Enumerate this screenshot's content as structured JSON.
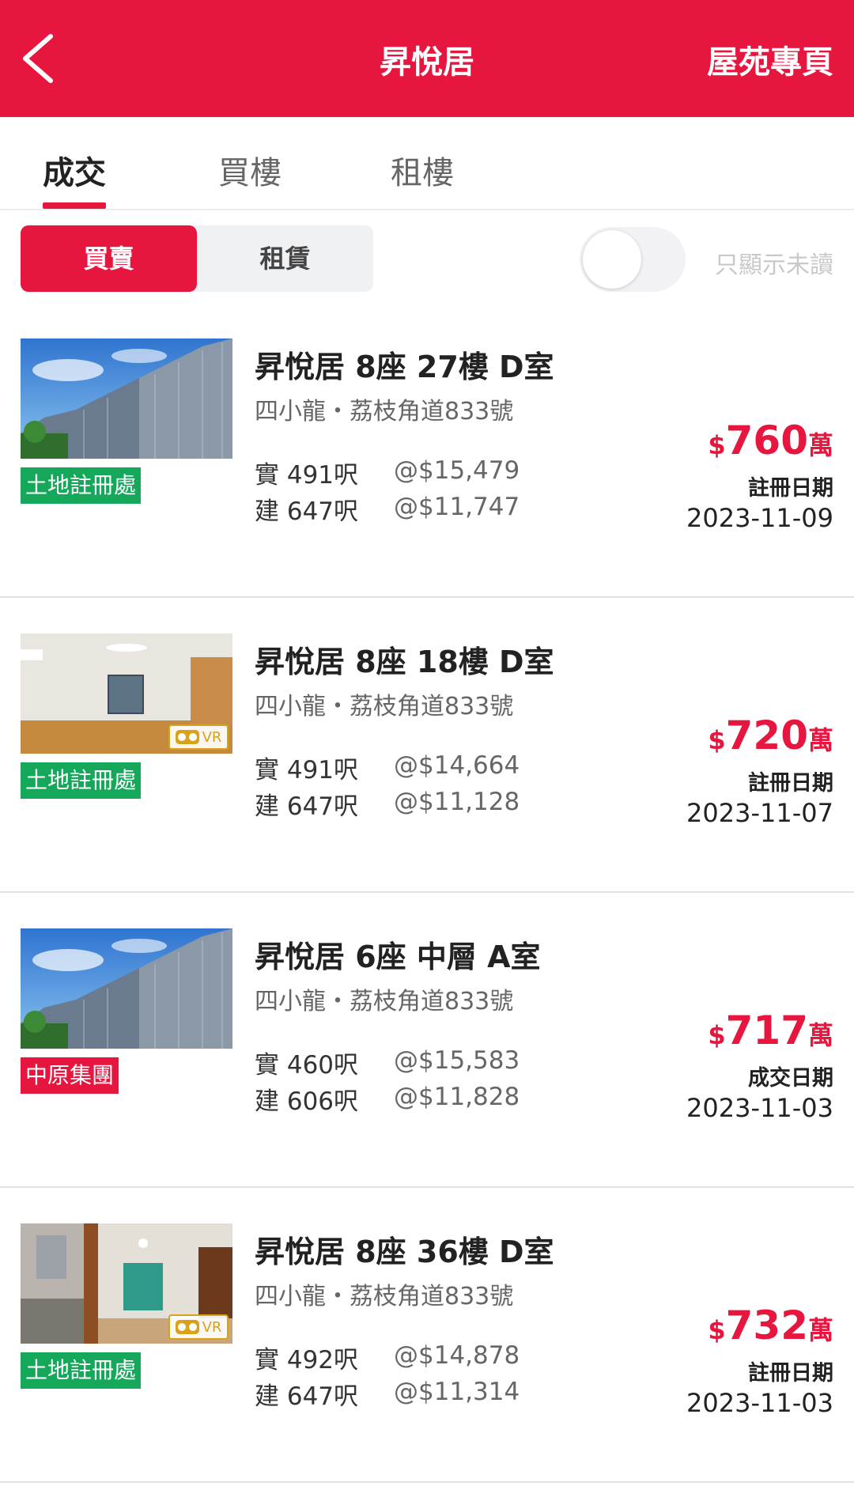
{
  "header": {
    "title": "昇悅居",
    "link": "屋苑專頁",
    "back_icon": "chevron-left-icon"
  },
  "tabs": [
    {
      "label": "成交",
      "active": true
    },
    {
      "label": "買樓"
    },
    {
      "label": "租樓"
    }
  ],
  "segment": {
    "active": "買賣",
    "inactive": "租賃"
  },
  "unread_toggle": {
    "label": "只顯示未讀",
    "on": false
  },
  "colors": {
    "brand": "#e6163f",
    "land_registry_tag": "#16a85a",
    "centaline_tag": "#e6163f",
    "vr_badge": "#d8a318"
  },
  "listings": [
    {
      "title": "昇悅居 8座 27樓 D室",
      "address": "四小龍・荔枝角道833號",
      "source": "土地註冊處",
      "image": "building-exterior-photo",
      "vr": false,
      "saleable": "實 491呎",
      "gross": "建 647呎",
      "saleable_unit_price": "@$15,479",
      "gross_unit_price": "@$11,747",
      "price_currency": "$",
      "price": "760",
      "price_unit": "萬",
      "date_label": "註冊日期",
      "date": "2023-11-09"
    },
    {
      "title": "昇悅居 8座 18樓 D室",
      "address": "四小龍・荔枝角道833號",
      "source": "土地註冊處",
      "image": "interior-room-photo",
      "vr": true,
      "vr_label": "VR",
      "saleable": "實 491呎",
      "gross": "建 647呎",
      "saleable_unit_price": "@$14,664",
      "gross_unit_price": "@$11,128",
      "price_currency": "$",
      "price": "720",
      "price_unit": "萬",
      "date_label": "註冊日期",
      "date": "2023-11-07"
    },
    {
      "title": "昇悅居 6座 中層 A室",
      "address": "四小龍・荔枝角道833號",
      "source": "中原集團",
      "image": "building-exterior-photo",
      "vr": false,
      "saleable": "實 460呎",
      "gross": "建 606呎",
      "saleable_unit_price": "@$15,583",
      "gross_unit_price": "@$11,828",
      "price_currency": "$",
      "price": "717",
      "price_unit": "萬",
      "date_label": "成交日期",
      "date": "2023-11-03"
    },
    {
      "title": "昇悅居 8座 36樓 D室",
      "address": "四小龍・荔枝角道833號",
      "source": "土地註冊處",
      "image": "kitchen-interior-photo",
      "vr": true,
      "vr_label": "VR",
      "saleable": "實 492呎",
      "gross": "建 647呎",
      "saleable_unit_price": "@$14,878",
      "gross_unit_price": "@$11,314",
      "price_currency": "$",
      "price": "732",
      "price_unit": "萬",
      "date_label": "註冊日期",
      "date": "2023-11-03"
    }
  ]
}
